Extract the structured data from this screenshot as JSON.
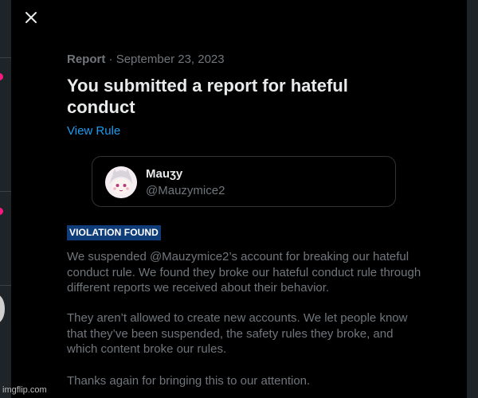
{
  "report": {
    "meta_label": "Report",
    "meta_separator": " · ",
    "meta_date": "September 23, 2023",
    "title": "You submitted a report for hateful conduct",
    "view_rule_label": "View Rule"
  },
  "user": {
    "display_name": "Mauʒy",
    "handle": "@Mauzymice2"
  },
  "violation_badge": "VIOLATION FOUND",
  "paragraphs": [
    "We suspended @Mauzymice2’s account for breaking our hateful conduct rule. We found they broke our hateful conduct rule through different reports we received about their behavior.",
    "They aren’t allowed to create new accounts. We let people know that they’ve been suspended, the safety rules they broke, and which content broke our rules.",
    "Thanks again for bringing this to our attention."
  ],
  "watermark": "imgflip.com",
  "icons": {
    "close": "close-icon"
  },
  "colors": {
    "background": "#000000",
    "text_primary": "#e7e9ea",
    "text_secondary": "#71767b",
    "link": "#1d9bf0",
    "badge_bg": "#0f3d7a"
  }
}
